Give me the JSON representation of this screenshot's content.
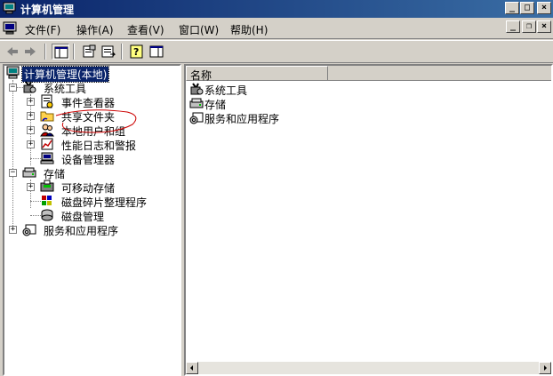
{
  "window": {
    "title": "计算机管理"
  },
  "caption_buttons": {
    "minimize": "_",
    "maximize": "□",
    "close": "×"
  },
  "menu": {
    "items": [
      {
        "label": "文件(F)"
      },
      {
        "label": "操作(A)"
      },
      {
        "label": "查看(V)"
      },
      {
        "label": "窗口(W)"
      },
      {
        "label": "帮助(H)"
      }
    ]
  },
  "mdi_buttons": {
    "minimize": "_",
    "restore": "❐",
    "close": "×"
  },
  "tree": {
    "root": "计算机管理(本地)",
    "system_tools": {
      "label": "系统工具",
      "children": [
        "事件查看器",
        "共享文件夹",
        "本地用户和组",
        "性能日志和警报",
        "设备管理器"
      ]
    },
    "storage": {
      "label": "存储",
      "children": [
        "可移动存储",
        "磁盘碎片整理程序",
        "磁盘管理"
      ]
    },
    "services": {
      "label": "服务和应用程序"
    }
  },
  "list": {
    "column_name": "名称",
    "items": [
      "系统工具",
      "存储",
      "服务和应用程序"
    ]
  },
  "colors": {
    "titlebar": "#0a246a",
    "selection": "#0a246a",
    "face": "#d4d0c8",
    "annotation": "#cc0000"
  }
}
